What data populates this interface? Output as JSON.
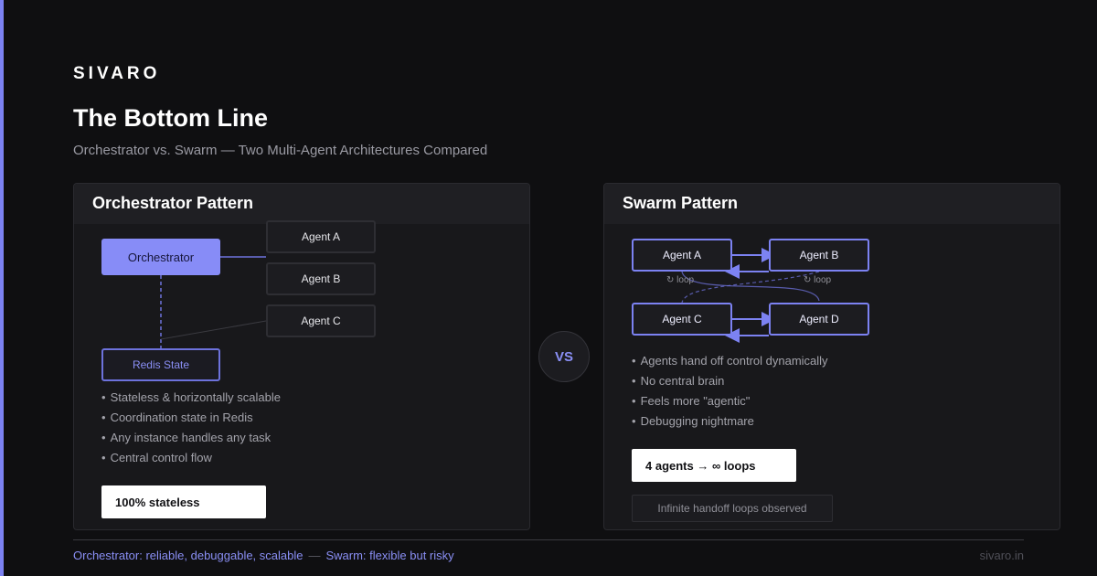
{
  "brand": "SIVARO",
  "title": "The Bottom Line",
  "subtitle": "Orchestrator vs. Swarm — Two Multi-Agent Architectures Compared",
  "orchestrator": {
    "heading": "Orchestrator Pattern",
    "orchestrator_node": "Orchestrator",
    "state_node": "Redis State",
    "agents": [
      "Agent A",
      "Agent B",
      "Agent C"
    ],
    "bullets": [
      "Stateless & horizontally scalable",
      "Coordination state in Redis",
      "Any instance handles any task",
      "Central control flow"
    ],
    "stat": "100% stateless"
  },
  "vs_label": "VS",
  "swarm": {
    "heading": "Swarm Pattern",
    "agents": [
      "Agent A",
      "Agent B",
      "Agent C",
      "Agent D"
    ],
    "loop_labels": [
      "↻ loop",
      "↻ loop"
    ],
    "bullets": [
      "Agents hand off control dynamically",
      "No central brain",
      "Feels more \"agentic\"",
      "Debugging nightmare"
    ],
    "stat": "4 agents → ∞ loops",
    "note": "Infinite handoff loops observed"
  },
  "footer": {
    "orchestrator_summary": "Orchestrator: reliable, debuggable, scalable",
    "separator": "—",
    "swarm_summary": "Swarm: flexible but risky",
    "site": "sivaro.in"
  },
  "colors": {
    "accent": "#7c82f2",
    "orchestrator_fill": "#878cf7",
    "background": "#0f0f11",
    "panel": "#18181b"
  }
}
